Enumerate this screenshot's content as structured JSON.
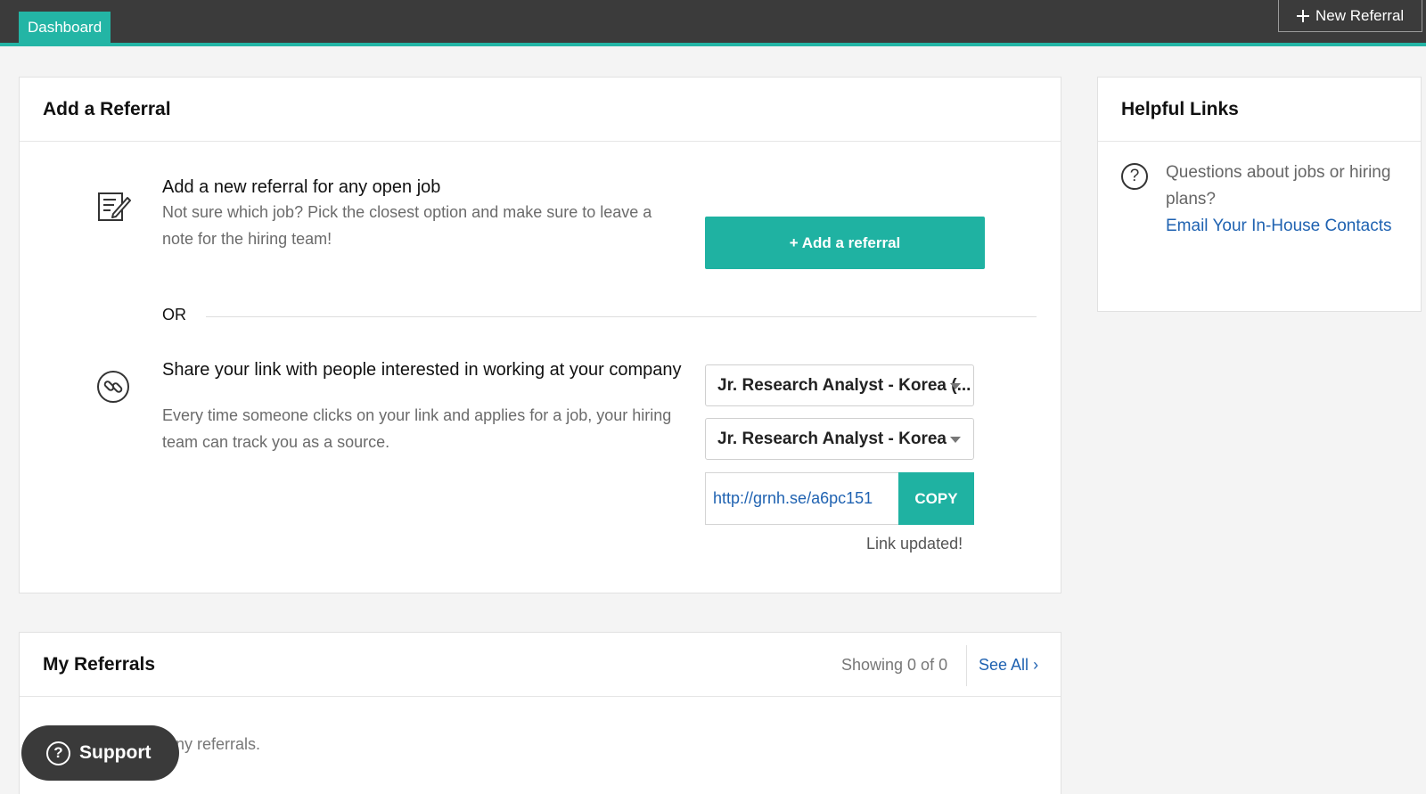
{
  "topbar": {
    "dashboard_tab": "Dashboard",
    "new_referral_label": "New Referral"
  },
  "add_referral": {
    "title": "Add a Referral",
    "option1": {
      "title": "Add a new referral for any open job",
      "description": "Not sure which job? Pick the closest option and make sure to leave a note for the hiring team!",
      "button_label": "+ Add a referral"
    },
    "or_label": "OR",
    "option2": {
      "title": "Share your link with people interested in working at your company",
      "description": "Every time someone clicks on your link and applies for a job, your hiring team can track you as a source.",
      "select1_value": "Jr. Research Analyst - Korea (...",
      "select2_value": "Jr. Research Analyst - Korea",
      "link_url": "http://grnh.se/a6pc151",
      "copy_label": "COPY",
      "status_text": "Link updated!"
    }
  },
  "helpful_links": {
    "title": "Helpful Links",
    "question": "Questions about jobs or hiring plans?",
    "link_label": "Email Your In-House Contacts"
  },
  "my_referrals": {
    "title": "My Referrals",
    "showing": "Showing 0 of 0",
    "see_all": "See All",
    "empty_text": "ny referrals."
  },
  "support": {
    "label": "Support"
  },
  "colors": {
    "accent": "#1fb2a2",
    "topbar": "#3b3b3b",
    "link": "#1f62b1"
  }
}
